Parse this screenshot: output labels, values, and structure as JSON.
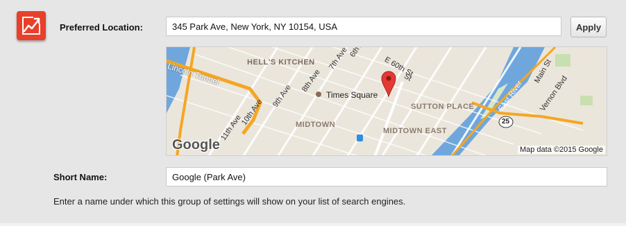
{
  "location": {
    "label": "Preferred Location:",
    "value": "345 Park Ave, New York, NY 10154, USA",
    "apply_label": "Apply"
  },
  "map": {
    "labels": {
      "hells_kitchen": "HELL'S KITCHEN",
      "lincoln_tunnel": "Lincoln Tunnel",
      "e60th": "E 60th St",
      "st": "St",
      "ave7": "7th Ave",
      "ave6": "6th Ave",
      "ave8": "8th Ave",
      "ave9": "9th Ave",
      "ave10": "10th Ave",
      "ave11": "11th Ave",
      "times_square": "Times Square",
      "sutton_place": "SUTTON PLACE",
      "midtown": "MIDTOWN",
      "midtown_east": "MIDTOWN EAST",
      "east_river": "East River",
      "main_st": "Main St",
      "vernon_blvd": "Vernon Blvd",
      "route": "25",
      "google_logo": "Google",
      "attribution": "Map data ©2015 Google"
    }
  },
  "short_name": {
    "label": "Short Name:",
    "value": "Google (Park Ave)"
  },
  "help_text": "Enter a name under which this group of settings will show on your list of search engines.",
  "colors": {
    "accent": "#e8402a",
    "panel_bg": "#e6e6e6",
    "map_land": "#ebe6dc",
    "map_water": "#6fa7dd",
    "map_highway": "#f5a623"
  }
}
